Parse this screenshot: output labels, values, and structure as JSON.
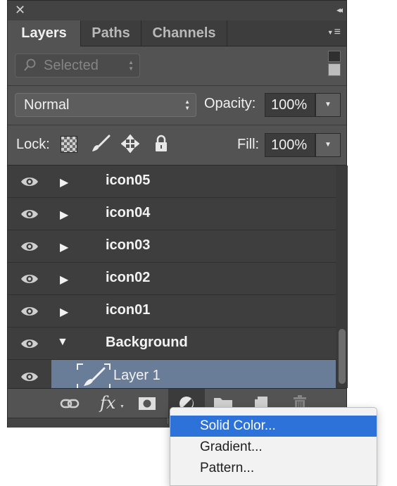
{
  "window": {
    "close_glyph": "✕",
    "collapse_glyph": "◂◂"
  },
  "tabs": [
    {
      "label": "Layers",
      "active": true
    },
    {
      "label": "Paths",
      "active": false
    },
    {
      "label": "Channels",
      "active": false
    }
  ],
  "panel_menu_glyph": "≡",
  "filter": {
    "value": "Selected",
    "icon": "search-icon"
  },
  "blend": {
    "mode": "Normal",
    "opacity_label": "Opacity:",
    "opacity_value": "100%"
  },
  "lock": {
    "label": "Lock:",
    "icons": [
      "lock-transparent-pixels-icon",
      "lock-image-pixels-icon",
      "lock-position-icon",
      "lock-all-icon"
    ],
    "fill_label": "Fill:",
    "fill_value": "100%"
  },
  "layers": [
    {
      "name": "icon05",
      "type": "group",
      "expanded": false
    },
    {
      "name": "icon04",
      "type": "group",
      "expanded": false
    },
    {
      "name": "icon03",
      "type": "group",
      "expanded": false
    },
    {
      "name": "icon02",
      "type": "group",
      "expanded": false
    },
    {
      "name": "icon01",
      "type": "group",
      "expanded": false
    },
    {
      "name": "Background",
      "type": "group",
      "expanded": true
    },
    {
      "name": "Layer 1",
      "type": "layer",
      "selected": true
    }
  ],
  "bottom_toolbar": {
    "icons": [
      "link-icon",
      "fx-icon",
      "mask-icon",
      "adjustment-layer-icon",
      "new-group-icon",
      "new-layer-icon",
      "delete-icon"
    ],
    "fx_label": "fx"
  },
  "adjustment_menu": {
    "items": [
      {
        "label": "Solid Color...",
        "highlighted": true
      },
      {
        "label": "Gradient...",
        "highlighted": false
      },
      {
        "label": "Pattern...",
        "highlighted": false
      }
    ]
  },
  "colors": {
    "panel_bg": "#535353",
    "list_bg": "#3e3e3e",
    "selection": "#6a7d98",
    "menu_highlight": "#2d72d9"
  }
}
